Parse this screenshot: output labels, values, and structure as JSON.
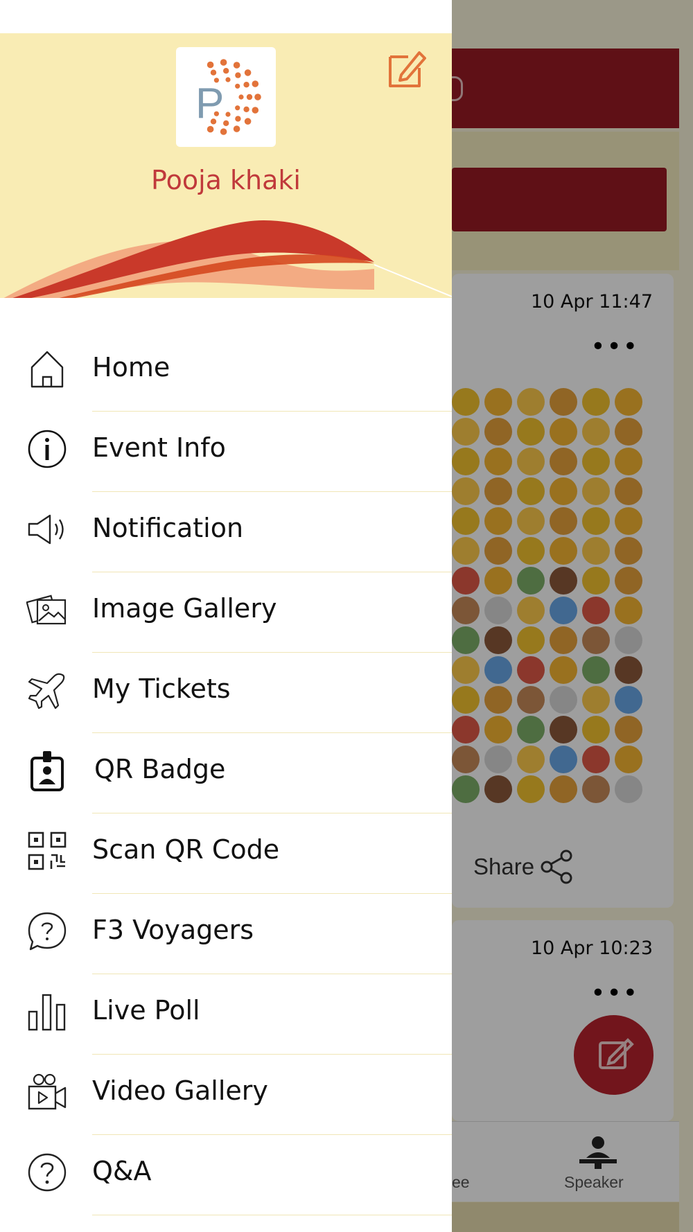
{
  "background_screen": {
    "posts": [
      {
        "timestamp": "10 Apr 11:47",
        "more_label": "•••",
        "share_label": "Share"
      },
      {
        "timestamp": "10 Apr 10:23",
        "more_label": "•••"
      }
    ],
    "tabbar": {
      "partial_label": "ee",
      "speaker_label": "Speaker"
    }
  },
  "drawer": {
    "user_name": "Pooja khaki",
    "logo_letter": "P",
    "menu": [
      {
        "label": "Home",
        "icon": "home-icon"
      },
      {
        "label": "Event Info",
        "icon": "info-icon"
      },
      {
        "label": "Notification",
        "icon": "megaphone-icon"
      },
      {
        "label": "Image Gallery",
        "icon": "image-gallery-icon"
      },
      {
        "label": "My Tickets",
        "icon": "airplane-icon"
      },
      {
        "label": "QR Badge",
        "icon": "badge-icon"
      },
      {
        "label": "Scan QR Code",
        "icon": "qr-code-icon"
      },
      {
        "label": "F3 Voyagers",
        "icon": "chat-question-icon"
      },
      {
        "label": "Live Poll",
        "icon": "bar-chart-icon"
      },
      {
        "label": "Video Gallery",
        "icon": "video-camera-icon"
      },
      {
        "label": "Q&A",
        "icon": "question-circle-icon"
      }
    ]
  },
  "colors": {
    "drawer_header_bg": "#f9ecb4",
    "user_name": "#c0393b",
    "accent_orange": "#e2733a",
    "brand_red": "#9a1b25"
  }
}
